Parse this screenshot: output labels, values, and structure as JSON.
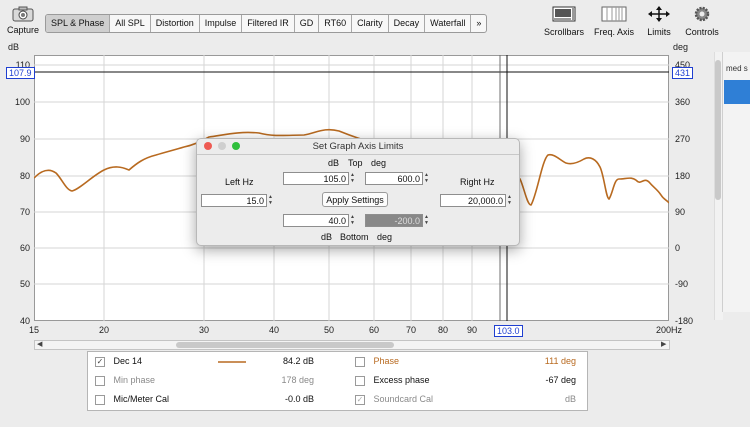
{
  "toolbar": {
    "capture_label": "Capture",
    "tabs": [
      "SPL & Phase",
      "All SPL",
      "Distortion",
      "Impulse",
      "Filtered IR",
      "GD",
      "RT60",
      "Clarity",
      "Decay",
      "Waterfall",
      "»"
    ],
    "active_tab": "SPL & Phase",
    "tools": [
      "Scrollbars",
      "Freq. Axis",
      "Limits",
      "Controls"
    ]
  },
  "graph": {
    "left_unit": "dB",
    "right_unit": "deg",
    "left_ticks": [
      "110",
      "100",
      "90",
      "80",
      "70",
      "60",
      "50",
      "40"
    ],
    "right_ticks": [
      "450",
      "360",
      "270",
      "180",
      "90",
      "0",
      "-90",
      "-180"
    ],
    "x_ticks": [
      "15",
      "20",
      "30",
      "40",
      "50",
      "60",
      "70",
      "80",
      "90",
      "200Hz"
    ],
    "cursor_left": "107.9",
    "cursor_right": "431",
    "cursor_x": "103.0",
    "trace_color": "#b86a20",
    "grid_color": "#d6d6d6"
  },
  "dialog": {
    "title": "Set Graph Axis Limits",
    "top_db_label": "dB",
    "top_label": "Top",
    "top_deg_label": "deg",
    "top_db_value": "105.0",
    "top_deg_value": "600.0",
    "left_hz_label": "Left Hz",
    "left_hz_value": "15.0",
    "right_hz_label": "Right Hz",
    "right_hz_value": "20,000.0",
    "apply_label": "Apply Settings",
    "bottom_db_value": "40.0",
    "bottom_deg_value": "-200.0",
    "bottom_db_label": "dB",
    "bottom_label": "Bottom",
    "bottom_deg_label": "deg"
  },
  "right_panel": {
    "label": "med s"
  },
  "legend": {
    "rows": [
      {
        "name": "Dec 14",
        "value": "84.2 dB",
        "name2": "Phase",
        "value2": "111 deg"
      },
      {
        "name": "Min phase",
        "value": "178 deg",
        "name2": "Excess phase",
        "value2": "-67 deg"
      },
      {
        "name": "Mic/Meter Cal",
        "value": "-0.0 dB",
        "name2": "Soundcard Cal",
        "value2": "dB"
      }
    ]
  }
}
